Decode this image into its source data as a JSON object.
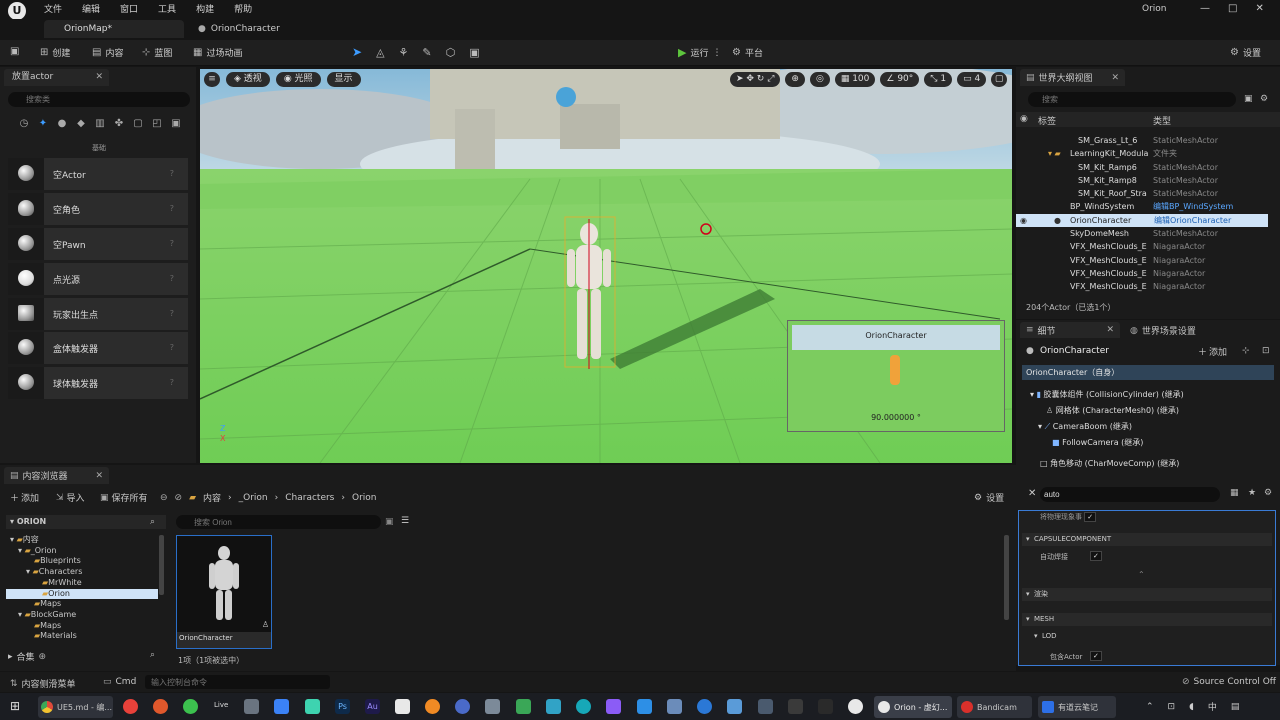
{
  "app": {
    "title": "Orion",
    "logo": "U"
  },
  "menu": [
    "文件",
    "编辑",
    "窗口",
    "工具",
    "构建",
    "帮助"
  ],
  "window_controls": [
    "—",
    "□",
    "✕"
  ],
  "doc_tabs": {
    "map": "OrionMap*",
    "character": "OrionCharacter"
  },
  "toolbar": {
    "create": "创建",
    "content": "内容",
    "blueprint": "蓝图",
    "cinematics": "过场动画",
    "play": "运行",
    "platform": "平台",
    "settings": "设置"
  },
  "place_actors": {
    "tab": "放置actor",
    "search_placeholder": "搜索类",
    "category": "基础",
    "items": [
      "空Actor",
      "空角色",
      "空Pawn",
      "点光源",
      "玩家出生点",
      "盒体触发器",
      "球体触发器"
    ]
  },
  "viewport": {
    "perspective": "透视",
    "lit": "光照",
    "show": "显示",
    "grid_size": "100",
    "angle": "90°",
    "scale": "1",
    "camera_speed": "4",
    "pip_title": "OrionCharacter",
    "pip_fov": "90.000000 °"
  },
  "outliner": {
    "tab": "世界大纲视图",
    "search_placeholder": "搜索",
    "col_label": "标签",
    "col_type": "类型",
    "rows": [
      {
        "name": "SM_Grass_Lt_6",
        "type": "StaticMeshActor"
      },
      {
        "name": "LearningKit_Modula",
        "type": "文件夹"
      },
      {
        "name": "SM_Kit_Ramp6",
        "type": "StaticMeshActor"
      },
      {
        "name": "SM_Kit_Ramp8",
        "type": "StaticMeshActor"
      },
      {
        "name": "SM_Kit_Roof_Stra",
        "type": "StaticMeshActor"
      },
      {
        "name": "BP_WindSystem",
        "type": "编辑BP_WindSystem"
      },
      {
        "name": "OrionCharacter",
        "type": "编辑OrionCharacter"
      },
      {
        "name": "SkyDomeMesh",
        "type": "StaticMeshActor"
      },
      {
        "name": "VFX_MeshClouds_E",
        "type": "NiagaraActor"
      },
      {
        "name": "VFX_MeshClouds_E",
        "type": "NiagaraActor"
      },
      {
        "name": "VFX_MeshClouds_E",
        "type": "NiagaraActor"
      },
      {
        "name": "VFX_MeshClouds_E",
        "type": "NiagaraActor"
      }
    ],
    "count": "204个Actor（已选1个）"
  },
  "details": {
    "tab": "细节",
    "world_settings_tab": "世界场景设置",
    "actor_name": "OrionCharacter",
    "add": "添加",
    "self_row": "OrionCharacter（自身）",
    "components": [
      "胶囊体组件 (CollisionCylinder) (继承)",
      "网格体 (CharacterMesh0) (继承)",
      "CameraBoom (继承)",
      "FollowCamera (继承)",
      "角色移动 (CharMoveComp) (继承)"
    ],
    "search_value": "auto",
    "props": {
      "partial": "将物理现象事",
      "capsule_header": "CAPSULECOMPONENT",
      "auto_weld": "自动焊接",
      "render_header": "渲染",
      "mesh_header": "MESH",
      "lod_header": "LOD",
      "include_actor": "包含Actor"
    }
  },
  "content_browser": {
    "tab": "内容浏览器",
    "add": "添加",
    "import": "导入",
    "save_all": "保存所有",
    "breadcrumb": [
      "内容",
      "_Orion",
      "Characters",
      "Orion"
    ],
    "settings": "设置",
    "tree_header": "ORION",
    "tree": [
      "内容",
      "_Orion",
      "Blueprints",
      "Characters",
      "MrWhite",
      "Orion",
      "Maps",
      "BlockGame",
      "Maps",
      "Materials"
    ],
    "search_placeholder": "搜索 Orion",
    "asset_name": "OrionCharacter",
    "collections": "合集",
    "item_count": "1项（1项被选中）"
  },
  "status": {
    "drawer": "内容侧滑菜单",
    "cmd": "Cmd",
    "console_placeholder": "输入控制台命令",
    "source_control": "Source Control Off"
  },
  "taskbar": {
    "chrome": "UE5.md - 编...",
    "live": "Live",
    "ue_window": "Orion - 虚幻...",
    "bandicam": "Bandicam",
    "notes": "有道云笔记"
  }
}
